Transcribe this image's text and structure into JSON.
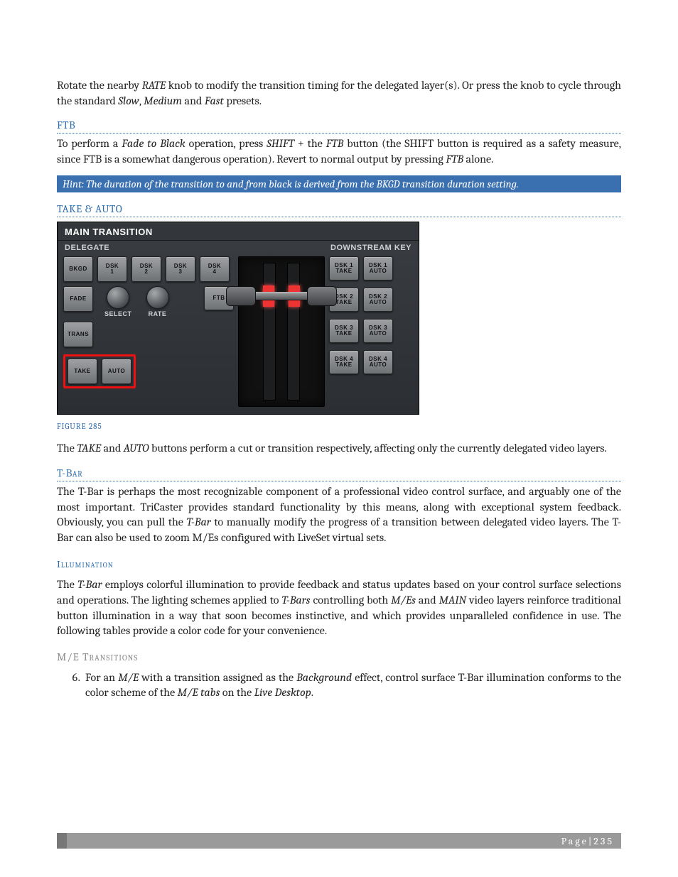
{
  "intro": {
    "p1_a": "Rotate the nearby ",
    "p1_rate": "RATE",
    "p1_b": " knob to modify the transition timing for the delegated layer(s).  Or press the knob to cycle through the standard ",
    "p1_slow": "Slow",
    "p1_c": ", ",
    "p1_medium": "Medium",
    "p1_d": " and ",
    "p1_fast": "Fast",
    "p1_e": " presets."
  },
  "ftb": {
    "heading": "FTB",
    "p_a": "To perform a ",
    "p_ftb_long": "Fade to Black",
    "p_b": " operation, press ",
    "p_shift": "SHIFT",
    "p_c": " + the ",
    "p_ftb": "FTB",
    "p_d": " button (the SHIFT button is required as a safety measure, since FTB is a somewhat dangerous operation). Revert to normal output by pressing ",
    "p_ftb2": "FTB",
    "p_e": " alone.",
    "hint": "Hint: The duration of the transition to and from black is derived from the BKGD transition duration setting."
  },
  "takeauto": {
    "heading": "TAKE & AUTO",
    "caption": "FIGURE 285",
    "p_a": "The ",
    "p_take": "TAKE",
    "p_b": " and ",
    "p_auto": "AUTO",
    "p_c": " buttons perform a cut or transition respectively, affecting only the currently delegated video layers."
  },
  "tbar": {
    "heading": "T-Bar",
    "p_a": "The T-Bar is perhaps the most recognizable component of a professional video control surface, and arguably one of the most important.  TriCaster provides standard functionality by this means, along with exceptional system feedback. Obviously, you can pull the ",
    "p_italic": "T-Bar",
    "p_b": " to manually modify the progress of a transition between delegated video layers.  The T-Bar can also be used to zoom M/Es configured with LiveSet virtual sets."
  },
  "illum": {
    "heading": "Illumination",
    "p_a": "The ",
    "p_tbar": "T-Bar",
    "p_b": " employs colorful illumination to provide feedback and status updates based on your control surface selections and operations.  The lighting schemes applied to ",
    "p_tbars": "T-Bars",
    "p_c": " controlling both ",
    "p_mes": "M/Es",
    "p_d": " and ",
    "p_main": "MAIN",
    "p_e": " video layers reinforce traditional button illumination in a way that soon becomes instinctive, and which provides unparalleled confidence in use. The following tables provide a color code for your convenience."
  },
  "metrans": {
    "heading": "M/E Transitions",
    "li6_a": "For an ",
    "li6_me": "M/E",
    "li6_b": " with a transition assigned as the ",
    "li6_bg": "Background",
    "li6_c": " effect, control surface T-Bar illumination conforms to the color scheme of the ",
    "li6_tabs": "M/E tabs",
    "li6_d": " on the ",
    "li6_ld": "Live Desktop",
    "li6_e": "."
  },
  "panel": {
    "title": "MAIN TRANSITION",
    "sub_left": "DELEGATE",
    "sub_right": "DOWNSTREAM KEY",
    "bkgd": "BKGD",
    "dsk1": "DSK\n1",
    "dsk2": "DSK\n2",
    "dsk3": "DSK\n3",
    "dsk4": "DSK\n4",
    "fade": "FADE",
    "ftb": "FTB",
    "trans": "TRANS",
    "select": "SELECT",
    "rate": "RATE",
    "take": "TAKE",
    "auto": "AUTO",
    "right": [
      {
        "take": "DSK 1\nTAKE",
        "auto": "DSK 1\nAUTO"
      },
      {
        "take": "DSK 2\nTAKE",
        "auto": "DSK 2\nAUTO"
      },
      {
        "take": "DSK 3\nTAKE",
        "auto": "DSK 3\nAUTO"
      },
      {
        "take": "DSK 4\nTAKE",
        "auto": "DSK 4\nAUTO"
      }
    ]
  },
  "footer": {
    "page_label": "Page",
    "sep": " | ",
    "num": "235"
  }
}
